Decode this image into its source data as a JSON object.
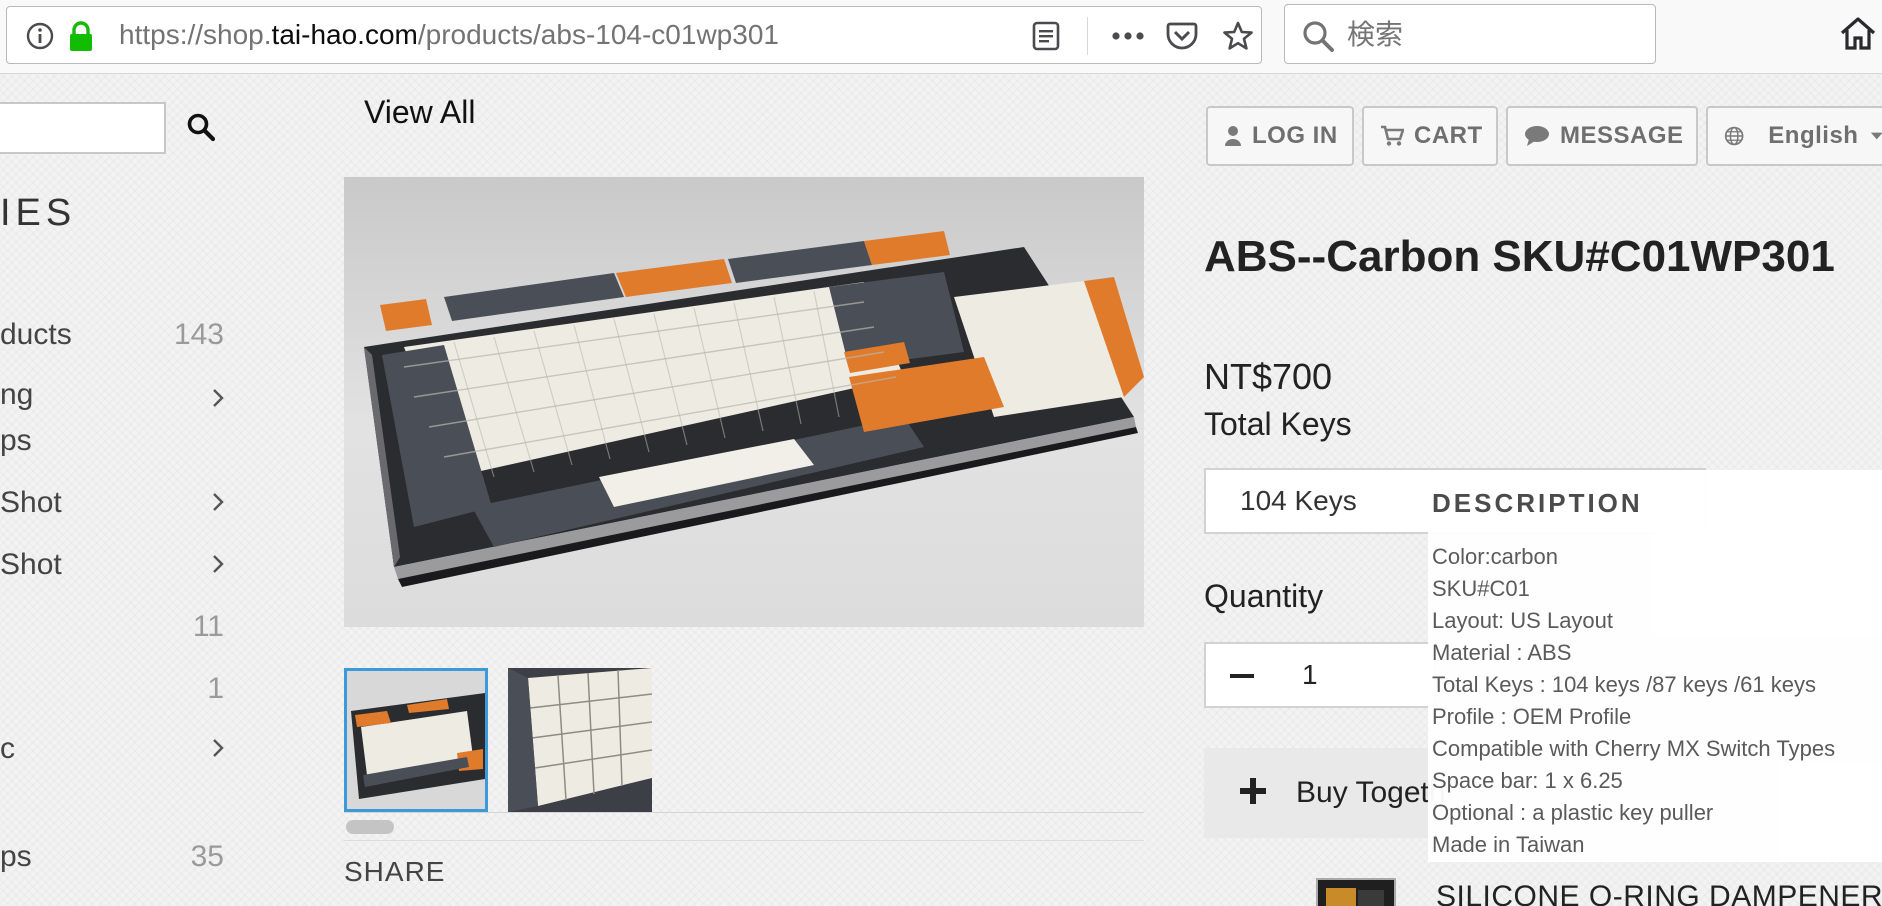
{
  "browser": {
    "url_prefix": "https://shop.",
    "url_host": "tai-hao.com",
    "url_path": "/products/abs-104-c01wp301",
    "search_placeholder": "検索"
  },
  "sidebar": {
    "heading": "IES",
    "categories": [
      {
        "label": "ducts",
        "count": "143"
      },
      {
        "label": "ng",
        "label2": "ps"
      },
      {
        "label": "Shot"
      },
      {
        "label": "Shot"
      },
      {
        "label": "",
        "count": "11"
      },
      {
        "label": "",
        "count": "1"
      },
      {
        "label": "c"
      },
      {
        "label": "ps",
        "count": "35"
      }
    ]
  },
  "header": {
    "login": "LOG IN",
    "cart": "CART",
    "message": "MESSAGE",
    "language": "English"
  },
  "breadcrumb": {
    "view_all": "View All"
  },
  "product": {
    "title": "ABS--Carbon SKU#C01WP301",
    "price": "NT$700",
    "variant_label": "Total Keys",
    "variant_value": "104 Keys",
    "quantity_label": "Quantity",
    "quantity": "1",
    "buy_together": "Buy Togeth",
    "addon_title": "SILICONE O-RING DAMPENER",
    "share": "SHARE"
  },
  "description": {
    "heading": "DESCRIPTION",
    "lines": [
      "Color:carbon",
      "SKU#C01",
      "Layout: US Layout",
      "Material : ABS",
      "Total Keys : 104 keys /87 keys /61 keys",
      "Profile : OEM Profile",
      "Compatible with Cherry MX Switch Types",
      "Space bar: 1 x 6.25",
      "Optional :  a plastic key puller",
      "Made in Taiwan"
    ]
  },
  "colors": {
    "accent_orange": "#e07b2c",
    "key_dark": "#4a4f57",
    "key_cream": "#eeebe2",
    "thumb_border": "#3d9ad8"
  }
}
